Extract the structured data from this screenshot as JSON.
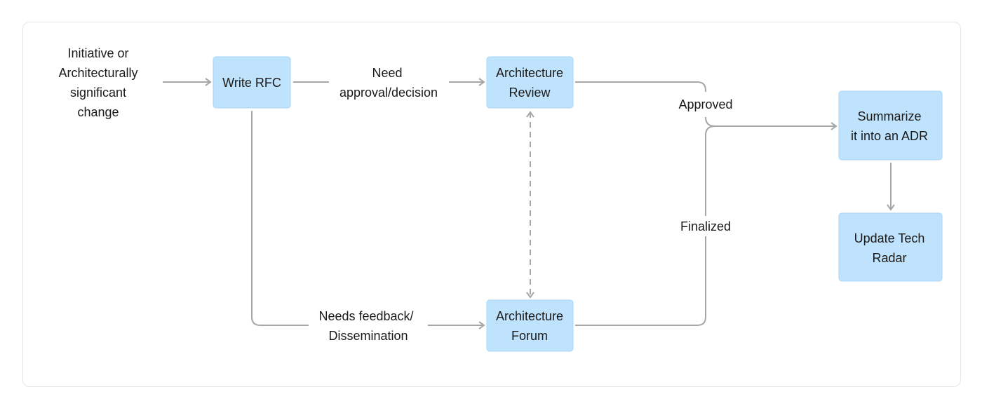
{
  "nodes": {
    "start": [
      "Initiative or",
      "Architecturally",
      "significant",
      "change"
    ],
    "write_rfc": [
      "Write RFC"
    ],
    "arch_review": [
      "Architecture",
      "Review"
    ],
    "arch_forum": [
      "Architecture",
      "Forum"
    ],
    "summarize": [
      "Summarize",
      "it into an ADR"
    ],
    "update_radar": [
      "Update Tech",
      "Radar"
    ]
  },
  "edges": {
    "need_approval": [
      "Need",
      "approval/decision"
    ],
    "needs_feedback": [
      "Needs feedback/",
      "Dissemination"
    ],
    "approved": "Approved",
    "finalized": "Finalized"
  },
  "colors": {
    "box_fill": "#bfe3fc",
    "line": "#a6a6a6"
  }
}
